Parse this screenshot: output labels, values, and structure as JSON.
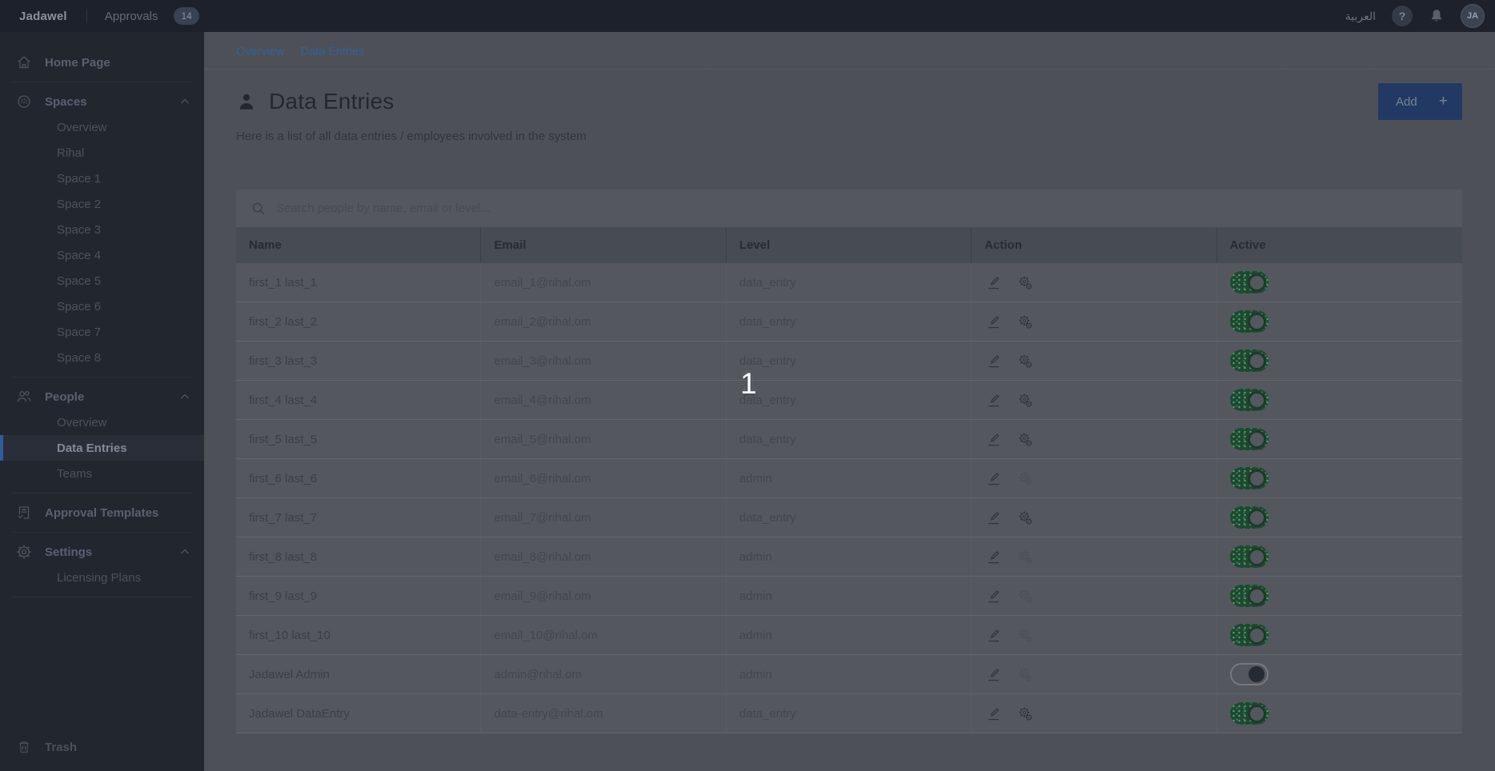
{
  "navbar": {
    "brand": "Jadawel",
    "approvals_label": "Approvals",
    "approvals_count": "14",
    "language_label": "العربية",
    "help_glyph": "?",
    "avatar_initials": "JA"
  },
  "sidebar": {
    "items": [
      {
        "type": "item",
        "id": "home-page",
        "icon": "home",
        "label": "Home Page"
      },
      {
        "type": "divider"
      },
      {
        "type": "item",
        "id": "spaces",
        "icon": "sphere",
        "label": "Spaces",
        "chevron": true
      },
      {
        "type": "child",
        "id": "spaces-overview",
        "label": "Overview"
      },
      {
        "type": "child",
        "id": "rihal",
        "label": "Rihal"
      },
      {
        "type": "child",
        "id": "space-1",
        "label": "Space 1"
      },
      {
        "type": "child",
        "id": "space-2",
        "label": "Space 2"
      },
      {
        "type": "child",
        "id": "space-3",
        "label": "Space 3"
      },
      {
        "type": "child",
        "id": "space-4",
        "label": "Space 4"
      },
      {
        "type": "child",
        "id": "space-5",
        "label": "Space 5"
      },
      {
        "type": "child",
        "id": "space-6",
        "label": "Space 6"
      },
      {
        "type": "child",
        "id": "space-7",
        "label": "Space 7"
      },
      {
        "type": "child",
        "id": "space-8",
        "label": "Space 8"
      },
      {
        "type": "divider"
      },
      {
        "type": "item",
        "id": "people",
        "icon": "people",
        "label": "People",
        "chevron": true
      },
      {
        "type": "child",
        "id": "people-overview",
        "label": "Overview"
      },
      {
        "type": "child",
        "id": "data-entries",
        "label": "Data Entries",
        "active": true
      },
      {
        "type": "child",
        "id": "teams",
        "label": "Teams"
      },
      {
        "type": "divider"
      },
      {
        "type": "item",
        "id": "approval-templates",
        "icon": "template",
        "label": "Approval Templates"
      },
      {
        "type": "divider"
      },
      {
        "type": "item",
        "id": "settings",
        "icon": "gear",
        "label": "Settings",
        "chevron": true
      },
      {
        "type": "child",
        "id": "licensing-plans",
        "label": "Licensing Plans"
      },
      {
        "type": "divider"
      }
    ],
    "trash_label": "Trash"
  },
  "breadcrumb": {
    "items": [
      "Overview",
      "Data Entries"
    ],
    "separator": "/"
  },
  "page": {
    "title": "Data Entries",
    "subtitle": "Here is a list of all data entries / employees involved in the system",
    "add_label": "Add",
    "add_icon": "+"
  },
  "search": {
    "placeholder": "Search people by name, email or level..."
  },
  "table": {
    "columns": [
      "Name",
      "Email",
      "Level",
      "Action",
      "Active"
    ],
    "rows": [
      {
        "name": "first_1 last_1",
        "email": "email_1@rihal.om",
        "level": "data_entry",
        "toggle": "green",
        "gear_enabled": true
      },
      {
        "name": "first_2 last_2",
        "email": "email_2@rihal.om",
        "level": "data_entry",
        "toggle": "green",
        "gear_enabled": true
      },
      {
        "name": "first_3 last_3",
        "email": "email_3@rihal.om",
        "level": "data_entry",
        "toggle": "green",
        "gear_enabled": true
      },
      {
        "name": "first_4 last_4",
        "email": "email_4@rihal.om",
        "level": "data_entry",
        "toggle": "green",
        "gear_enabled": true
      },
      {
        "name": "first_5 last_5",
        "email": "email_5@rihal.om",
        "level": "data_entry",
        "toggle": "green",
        "gear_enabled": true
      },
      {
        "name": "first_6 last_6",
        "email": "email_6@rihal.om",
        "level": "admin",
        "toggle": "green",
        "gear_enabled": false
      },
      {
        "name": "first_7 last_7",
        "email": "email_7@rihal.om",
        "level": "data_entry",
        "toggle": "green",
        "gear_enabled": true
      },
      {
        "name": "first_8 last_8",
        "email": "email_8@rihal.om",
        "level": "admin",
        "toggle": "green",
        "gear_enabled": false
      },
      {
        "name": "first_9 last_9",
        "email": "email_9@rihal.om",
        "level": "admin",
        "toggle": "green",
        "gear_enabled": false
      },
      {
        "name": "first_10 last_10",
        "email": "email_10@rihal.om",
        "level": "admin",
        "toggle": "green",
        "gear_enabled": false
      },
      {
        "name": "Jadawel Admin",
        "email": "admin@rihal.om",
        "level": "admin",
        "toggle": "gray",
        "gear_enabled": false
      },
      {
        "name": "Jadawel DataEntry",
        "email": "data-entry@rihal.om",
        "level": "data_entry",
        "toggle": "green",
        "gear_enabled": true
      }
    ]
  },
  "annotation": {
    "step_label": "1"
  },
  "colors": {
    "navbar_bg": "#1c212b",
    "sidebar_bg": "#22262f",
    "page_bg": "#4d5157",
    "card_bg": "#54575d",
    "accent_blue": "#2d5d9f",
    "link_blue": "#355f97",
    "button_blue": "#223a63",
    "toggle_green_track": "#214632",
    "toggle_green_dot": "#3fa866"
  }
}
